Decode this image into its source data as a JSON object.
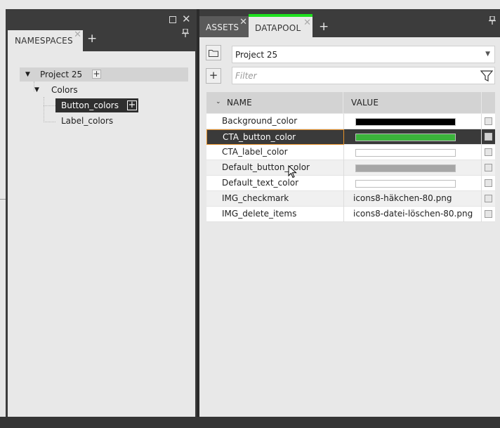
{
  "namespaces_panel": {
    "tab_label": "NAMESPACES",
    "tree": {
      "project": "Project 25",
      "group": "Colors",
      "items": [
        "Button_colors",
        "Label_colors"
      ]
    }
  },
  "datapool_panel": {
    "tabs": [
      {
        "label": "ASSETS"
      },
      {
        "label": "DATAPOOL",
        "accent": "#1ee01e"
      }
    ],
    "project_select": "Project 25",
    "filter_placeholder": "Filter",
    "columns": {
      "name": "NAME",
      "value": "VALUE"
    },
    "rows": [
      {
        "name": "Background_color",
        "type": "color",
        "value": "#000000"
      },
      {
        "name": "CTA_button_color",
        "type": "color",
        "value": "#3bb33b",
        "selected": true
      },
      {
        "name": "CTA_label_color",
        "type": "color",
        "value": "#ffffff"
      },
      {
        "name": "Default_button_color",
        "type": "color",
        "value": "#a6a6a6"
      },
      {
        "name": "Default_text_color",
        "type": "color",
        "value": "#ffffff"
      },
      {
        "name": "IMG_checkmark",
        "type": "image",
        "value": "icons8-häkchen-80.png"
      },
      {
        "name": "IMG_delete_items",
        "type": "image",
        "value": "icons8-datei-löschen-80.png"
      }
    ]
  },
  "icons": [
    "maximize-icon",
    "close-icon",
    "pin-icon",
    "add-icon",
    "folder-icon",
    "filter-icon",
    "chevron-down-icon",
    "mouse-cursor-icon"
  ]
}
